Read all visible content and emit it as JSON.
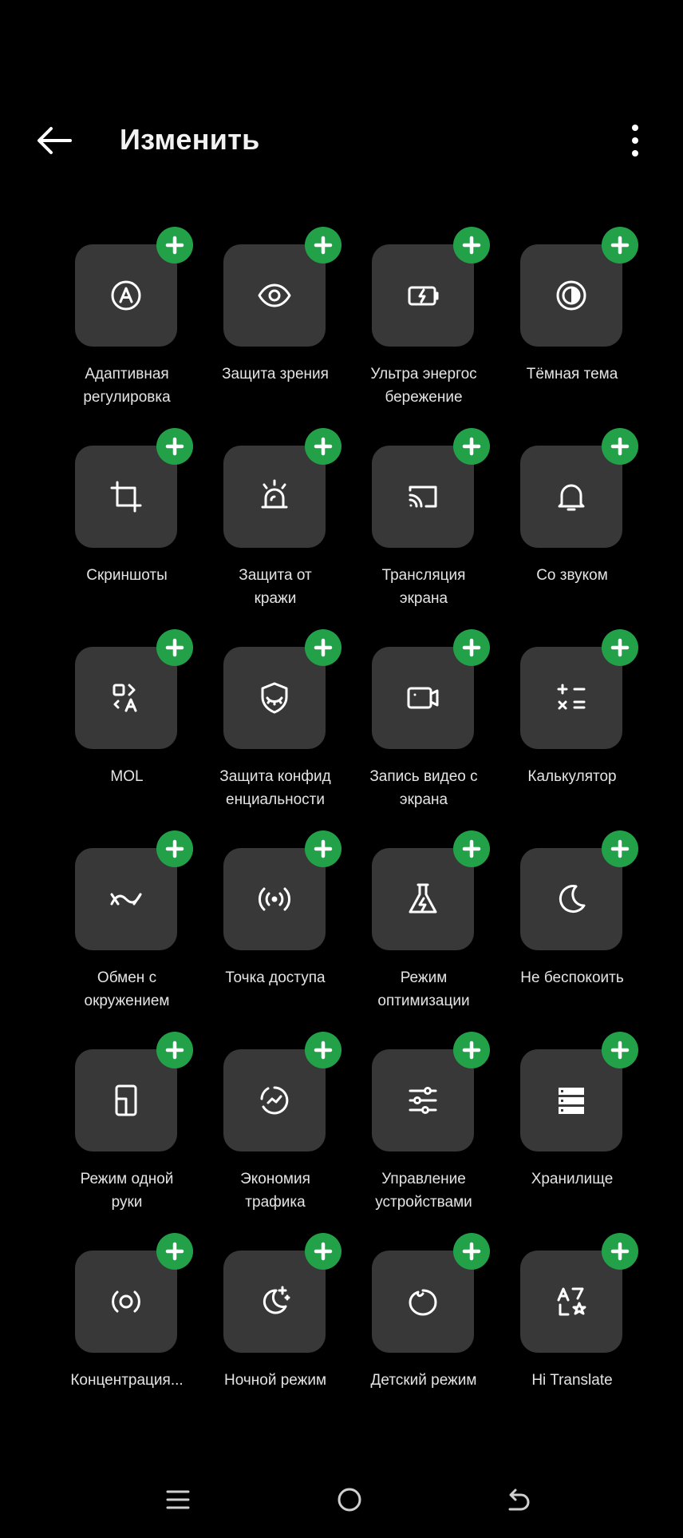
{
  "header": {
    "title": "Изменить",
    "back_icon": "arrow-left-icon",
    "more_icon": "more-vertical-icon"
  },
  "colors": {
    "background": "#000000",
    "tile": "#383838",
    "add_badge": "#23a149",
    "icon": "#ffffff",
    "text": "#e4e4e4"
  },
  "tiles": [
    {
      "label": "Адаптивная\nрегулировка",
      "icon": "auto-brightness-icon"
    },
    {
      "label": "Защита зрения",
      "icon": "eye-icon"
    },
    {
      "label": "Ультра энергос\nбережение",
      "icon": "battery-saver-icon"
    },
    {
      "label": "Тёмная тема",
      "icon": "dark-theme-icon"
    },
    {
      "label": "Скриншоты",
      "icon": "crop-icon"
    },
    {
      "label": "Защита от\nкражи",
      "icon": "alarm-light-icon"
    },
    {
      "label": "Трансляция\nэкрана",
      "icon": "cast-icon"
    },
    {
      "label": "Со звуком",
      "icon": "bell-icon"
    },
    {
      "label": "MOL",
      "icon": "translate-switch-icon"
    },
    {
      "label": "Защита конфид\nенциальности",
      "icon": "privacy-shield-icon"
    },
    {
      "label": "Запись видео с\nэкрана",
      "icon": "screen-record-icon"
    },
    {
      "label": "Калькулятор",
      "icon": "calculator-icon"
    },
    {
      "label": "Обмен с\nокружением",
      "icon": "nearby-share-icon"
    },
    {
      "label": "Точка доступа",
      "icon": "hotspot-icon"
    },
    {
      "label": "Режим\nоптимизации",
      "icon": "optimization-flask-icon"
    },
    {
      "label": "Не беспокоить",
      "icon": "moon-icon"
    },
    {
      "label": "Режим одной\nруки",
      "icon": "one-hand-icon"
    },
    {
      "label": "Экономия\nтрафика",
      "icon": "data-saver-icon"
    },
    {
      "label": "Управление\nустройствами",
      "icon": "sliders-icon"
    },
    {
      "label": "Хранилище",
      "icon": "storage-icon"
    },
    {
      "label": "Концентрация...",
      "icon": "focus-icon"
    },
    {
      "label": "Ночной режим",
      "icon": "night-mode-icon"
    },
    {
      "label": "Детский режим",
      "icon": "kids-mode-icon"
    },
    {
      "label": "Hi Translate",
      "icon": "hi-translate-icon"
    }
  ],
  "navbar": {
    "menu_icon": "menu-icon",
    "home_icon": "home-circle-icon",
    "back_icon": "back-return-icon"
  }
}
